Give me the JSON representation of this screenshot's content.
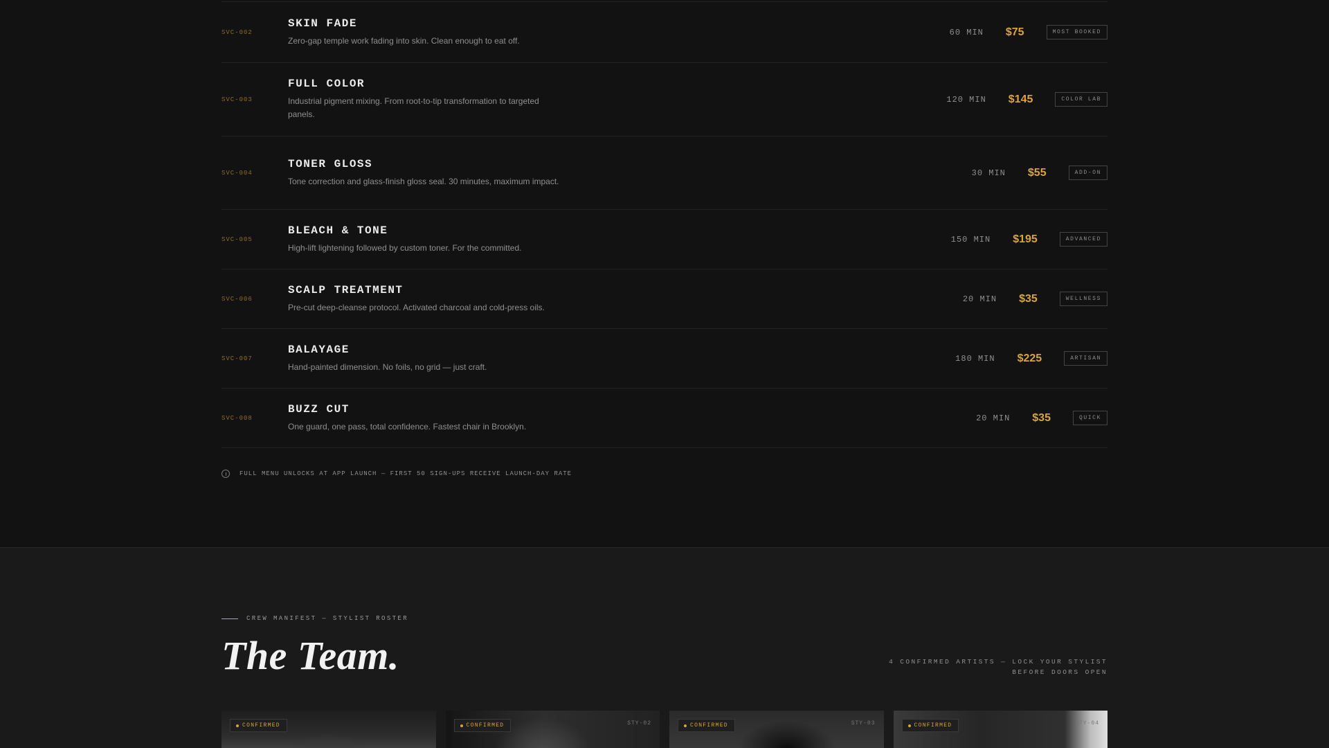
{
  "services": [
    {
      "code": "SVC-002",
      "name": "SKIN FADE",
      "description": "Zero-gap temple work fading into skin. Clean enough to eat off.",
      "duration": "60 MIN",
      "price": "$75",
      "badge": "MOST BOOKED"
    },
    {
      "code": "SVC-003",
      "name": "FULL COLOR",
      "description": "Industrial pigment mixing. From root-to-tip transformation to targeted panels.",
      "duration": "120 MIN",
      "price": "$145",
      "badge": "COLOR LAB"
    },
    {
      "code": "SVC-004",
      "name": "TONER GLOSS",
      "description": "Tone correction and glass-finish gloss seal. 30 minutes, maximum impact.",
      "duration": "30 MIN",
      "price": "$55",
      "badge": "ADD-ON"
    },
    {
      "code": "SVC-005",
      "name": "BLEACH & TONE",
      "description": "High-lift lightening followed by custom toner. For the committed.",
      "duration": "150 MIN",
      "price": "$195",
      "badge": "ADVANCED"
    },
    {
      "code": "SVC-006",
      "name": "SCALP TREATMENT",
      "description": "Pre-cut deep-cleanse protocol. Activated charcoal and cold-press oils.",
      "duration": "20 MIN",
      "price": "$35",
      "badge": "WELLNESS"
    },
    {
      "code": "SVC-007",
      "name": "BALAYAGE",
      "description": "Hand-painted dimension. No foils, no grid — just craft.",
      "duration": "180 MIN",
      "price": "$225",
      "badge": "ARTISAN"
    },
    {
      "code": "SVC-008",
      "name": "BUZZ CUT",
      "description": "One guard, one pass, total confidence. Fastest chair in Brooklyn.",
      "duration": "20 MIN",
      "price": "$35",
      "badge": "QUICK"
    }
  ],
  "menu_note": "FULL MENU UNLOCKS AT APP LAUNCH — FIRST 50 SIGN-UPS RECEIVE LAUNCH-DAY RATE",
  "team": {
    "eyebrow": "CREW MANIFEST — STYLIST ROSTER",
    "title": "The Team.",
    "caption": "4 CONFIRMED ARTISTS — LOCK YOUR STYLIST BEFORE DOORS OPEN",
    "cards": [
      {
        "status": "CONFIRMED",
        "code": ""
      },
      {
        "status": "CONFIRMED",
        "code": "STY-02"
      },
      {
        "status": "CONFIRMED",
        "code": "STY-03"
      },
      {
        "status": "CONFIRMED",
        "code": "STY-04"
      }
    ]
  },
  "colors": {
    "accent": "#d9a53a",
    "background": "#121212",
    "section_alt": "#1a1a1a"
  },
  "icons": {
    "note": "info-icon"
  }
}
